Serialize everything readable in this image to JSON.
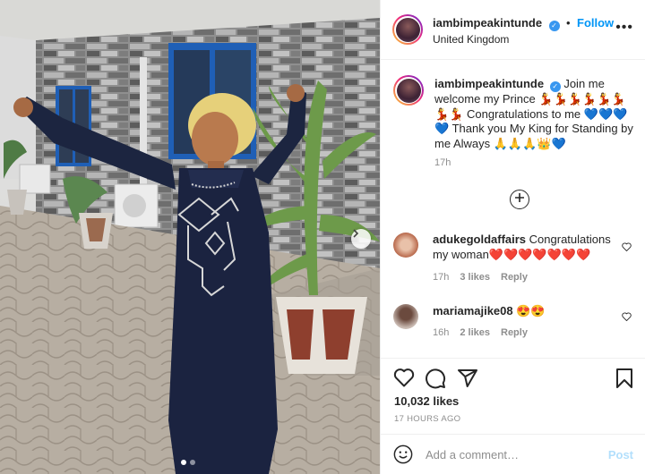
{
  "post": {
    "username": "iambimpeakintunde",
    "follow_label": "Follow",
    "location": "United Kingdom",
    "more_label": "•••"
  },
  "caption": {
    "username": "iambimpeakintunde",
    "text": "Join me welcome my Prince 💃💃💃💃💃💃💃💃 Congratulations to me 💙💙💙💙 Thank you My King for Standing by me Always 🙏🙏🙏👑💙",
    "time": "17h"
  },
  "comments": [
    {
      "username": "adukegoldaffairs",
      "text": "Congratulations my woman❤️❤️❤️❤️❤️❤️❤️",
      "time": "17h",
      "likes": "3 likes",
      "reply": "Reply"
    },
    {
      "username": "mariamajike08",
      "text": "😍😍",
      "time": "16h",
      "likes": "2 likes",
      "reply": "Reply"
    }
  ],
  "engagement": {
    "likes": "10,032 likes",
    "date": "17 HOURS AGO"
  },
  "composer": {
    "placeholder": "Add a comment…",
    "post_label": "Post"
  },
  "icons": {
    "like": "heart-icon",
    "comment": "comment-icon",
    "share": "send-icon",
    "save": "bookmark-icon",
    "emoji": "smiley-icon",
    "load_more": "plus-circle-icon",
    "next": "chevron-right-icon"
  },
  "colors": {
    "accent": "#0095f6",
    "post_disabled": "#b2dffc",
    "meta": "#8e8e8e"
  },
  "carousel": {
    "current": 1,
    "total": 2
  }
}
